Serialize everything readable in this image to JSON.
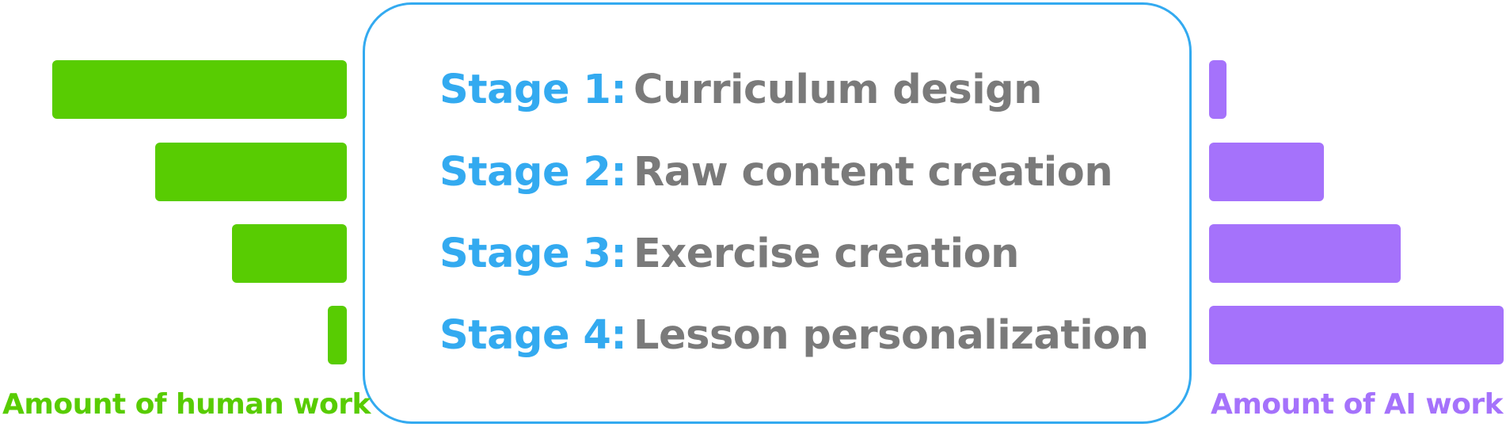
{
  "stages": [
    {
      "number": "Stage 1:",
      "name": "Curriculum design",
      "human_work": 1.0,
      "ai_work": 0.06
    },
    {
      "number": "Stage 2:",
      "name": "Raw content creation",
      "human_work": 0.65,
      "ai_work": 0.39
    },
    {
      "number": "Stage 3:",
      "name": "Exercise creation",
      "human_work": 0.39,
      "ai_work": 0.65
    },
    {
      "number": "Stage 4:",
      "name": "Lesson personalization",
      "human_work": 0.065,
      "ai_work": 1.0
    }
  ],
  "labels": {
    "human": "Amount of human work",
    "ai": "Amount of AI work"
  },
  "colors": {
    "stage_accent": "#33aaf0",
    "stage_text": "#7a7a7a",
    "human": "#58cc02",
    "ai": "#a572fb"
  }
}
